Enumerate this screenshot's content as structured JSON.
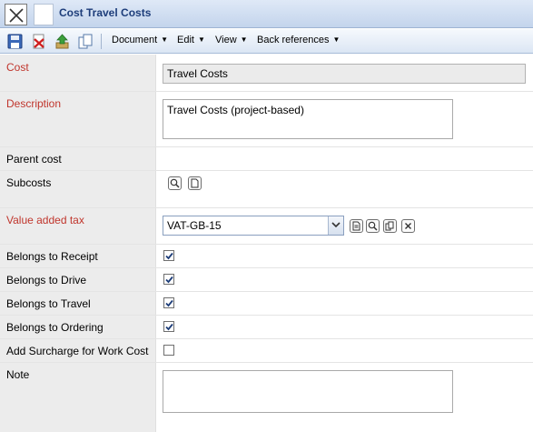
{
  "window": {
    "title": "Cost Travel Costs"
  },
  "toolbar": {
    "menus": [
      {
        "label": "Document"
      },
      {
        "label": "Edit"
      },
      {
        "label": "View"
      },
      {
        "label": "Back references"
      }
    ]
  },
  "form": {
    "cost": {
      "label": "Cost",
      "value": "Travel Costs"
    },
    "description": {
      "label": "Description",
      "value": "Travel Costs (project-based)"
    },
    "parent_cost": {
      "label": "Parent cost"
    },
    "subcosts": {
      "label": "Subcosts"
    },
    "vat": {
      "label": "Value added tax",
      "value": "VAT-GB-15"
    },
    "belongs_receipt": {
      "label": "Belongs to Receipt",
      "checked": true
    },
    "belongs_drive": {
      "label": "Belongs to Drive",
      "checked": true
    },
    "belongs_travel": {
      "label": "Belongs to Travel",
      "checked": true
    },
    "belongs_ordering": {
      "label": "Belongs to Ordering",
      "checked": true
    },
    "surcharge": {
      "label": "Add Surcharge for Work Cost",
      "checked": false
    },
    "note": {
      "label": "Note",
      "value": ""
    }
  },
  "colors": {
    "required_label": "#c0352c",
    "title_text": "#1d3d7a",
    "label_bg": "#ececec"
  }
}
